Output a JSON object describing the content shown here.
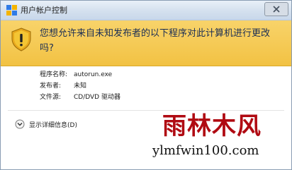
{
  "window": {
    "title": "用户帐户控制",
    "close_icon": "close-icon"
  },
  "banner": {
    "question": "您想允许来自未知发布者的以下程序对此计算机进行更改吗?",
    "icon": "uac-shield-warning-icon",
    "colors": {
      "background": "#f5c94f",
      "text": "#1a2d54"
    }
  },
  "details": {
    "program_name_label": "程序名称:",
    "program_name_value": "autorun.exe",
    "publisher_label": "发布者:",
    "publisher_value": "未知",
    "source_label": "文件源:",
    "source_value": "CD/DVD 驱动器"
  },
  "expander": {
    "label": "显示详细信息(D)",
    "icon": "chevron-down-circle-icon"
  },
  "watermark": {
    "title": "雨林木风",
    "url": "ylmfwin100.com",
    "color": "#b00a12"
  }
}
